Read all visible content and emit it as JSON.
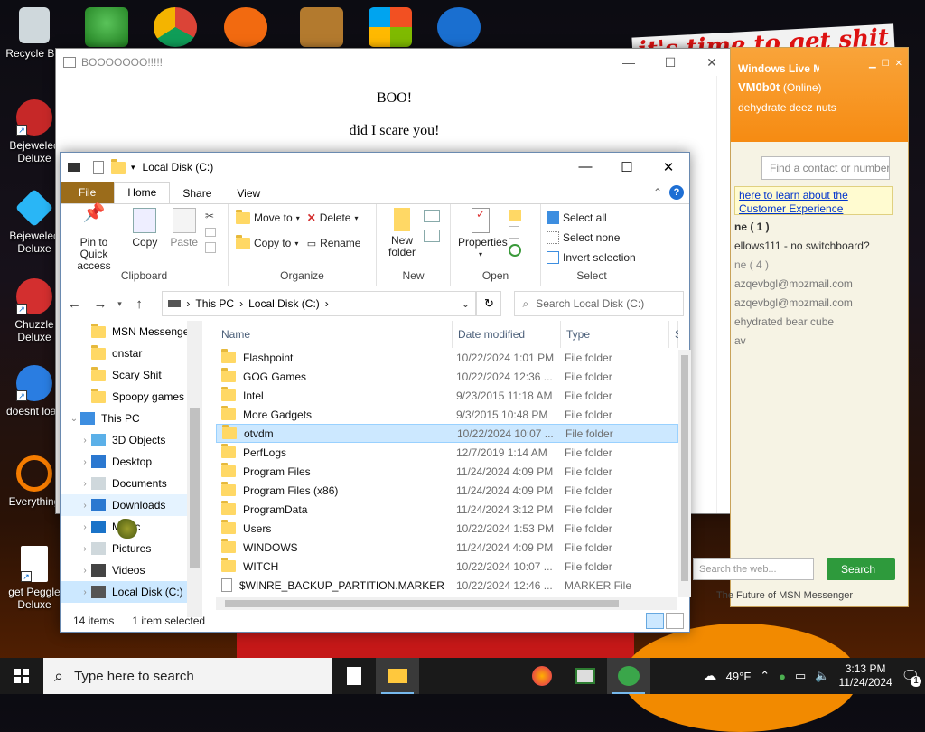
{
  "desktop": {
    "wallpaper_text": "it's time to get shit",
    "icons": [
      {
        "label": "Recycle Bin"
      },
      {
        "label": "Bejeweled Deluxe"
      },
      {
        "label": "Bejeweled Deluxe"
      },
      {
        "label": "Chuzzle Deluxe"
      },
      {
        "label": "doesnt load"
      },
      {
        "label": "Everything"
      },
      {
        "label": "get Peggle Deluxe"
      }
    ]
  },
  "boo_window": {
    "title": "BOOOOOOO!!!!!",
    "line1": "BOO!",
    "line2": "did I scare you!"
  },
  "msn": {
    "title": "Windows Live Messenger",
    "username": "VM0b0t",
    "status": "(Online)",
    "personal_message": "dehydrate deez nuts",
    "find_placeholder": "Find a contact or number...",
    "ad_link": "here to learn about the Customer Experience",
    "contacts": [
      "ne ( 1 )",
      "ellows111 - no switchboard?",
      "ne ( 4 )",
      "azqevbgl@mozmail.com",
      "azqevbgl@mozmail.com",
      "ehydrated bear cube",
      "av"
    ],
    "web_search_placeholder": "Search the web...",
    "search_button": "Search",
    "footer": "The Future of MSN Messenger"
  },
  "explorer": {
    "title": "Local Disk (C:)",
    "tabs": [
      "File",
      "Home",
      "Share",
      "View"
    ],
    "ribbon": {
      "clipboard": {
        "name": "Clipboard",
        "pin": "Pin to Quick access",
        "copy": "Copy",
        "paste": "Paste"
      },
      "organize": {
        "name": "Organize",
        "move_to": "Move to",
        "copy_to": "Copy to",
        "delete": "Delete",
        "rename": "Rename"
      },
      "new": {
        "name": "New",
        "new_folder": "New folder"
      },
      "open": {
        "name": "Open",
        "properties": "Properties"
      },
      "select": {
        "name": "Select",
        "select_all": "Select all",
        "select_none": "Select none",
        "invert": "Invert selection"
      }
    },
    "breadcrumb": [
      "This PC",
      "Local Disk (C:)"
    ],
    "search_placeholder": "Search Local Disk (C:)",
    "nav_items": [
      {
        "label": "MSN Messenger",
        "type": "folder"
      },
      {
        "label": "onstar",
        "type": "folder"
      },
      {
        "label": "Scary Shit",
        "type": "folder"
      },
      {
        "label": "Spoopy games",
        "type": "folder"
      },
      {
        "label": "This PC",
        "type": "pc"
      },
      {
        "label": "3D Objects",
        "type": "3d"
      },
      {
        "label": "Desktop",
        "type": "desktop"
      },
      {
        "label": "Documents",
        "type": "docs"
      },
      {
        "label": "Downloads",
        "type": "downloads"
      },
      {
        "label": "Music",
        "type": "music"
      },
      {
        "label": "Pictures",
        "type": "pictures"
      },
      {
        "label": "Videos",
        "type": "videos"
      },
      {
        "label": "Local Disk (C:)",
        "type": "disk"
      }
    ],
    "columns": [
      "Name",
      "Date modified",
      "Type",
      "S"
    ],
    "files": [
      {
        "name": "Flashpoint",
        "date": "10/22/2024 1:01 PM",
        "type": "File folder"
      },
      {
        "name": "GOG Games",
        "date": "10/22/2024 12:36 ...",
        "type": "File folder"
      },
      {
        "name": "Intel",
        "date": "9/23/2015 11:18 AM",
        "type": "File folder"
      },
      {
        "name": "More Gadgets",
        "date": "9/3/2015 10:48 PM",
        "type": "File folder"
      },
      {
        "name": "otvdm",
        "date": "10/22/2024 10:07 ...",
        "type": "File folder"
      },
      {
        "name": "PerfLogs",
        "date": "12/7/2019 1:14 AM",
        "type": "File folder"
      },
      {
        "name": "Program Files",
        "date": "11/24/2024 4:09 PM",
        "type": "File folder"
      },
      {
        "name": "Program Files (x86)",
        "date": "11/24/2024 4:09 PM",
        "type": "File folder"
      },
      {
        "name": "ProgramData",
        "date": "11/24/2024 3:12 PM",
        "type": "File folder"
      },
      {
        "name": "Users",
        "date": "10/22/2024 1:53 PM",
        "type": "File folder"
      },
      {
        "name": "WINDOWS",
        "date": "11/24/2024 4:09 PM",
        "type": "File folder"
      },
      {
        "name": "WITCH",
        "date": "10/22/2024 10:07 ...",
        "type": "File folder"
      },
      {
        "name": "$WINRE_BACKUP_PARTITION.MARKER",
        "date": "10/22/2024 12:46 ...",
        "type": "MARKER File"
      }
    ],
    "status": {
      "count": "14 items",
      "selected": "1 item selected"
    }
  },
  "taskbar": {
    "search_placeholder": "Type here to search",
    "weather": "49°F",
    "time": "3:13 PM",
    "date": "11/24/2024",
    "notifications": "1"
  },
  "colors": {
    "accent": "#0078d7",
    "file_tab": "#9b6c1b",
    "msn_orange": "#f68b12",
    "selection": "#cce8ff"
  }
}
